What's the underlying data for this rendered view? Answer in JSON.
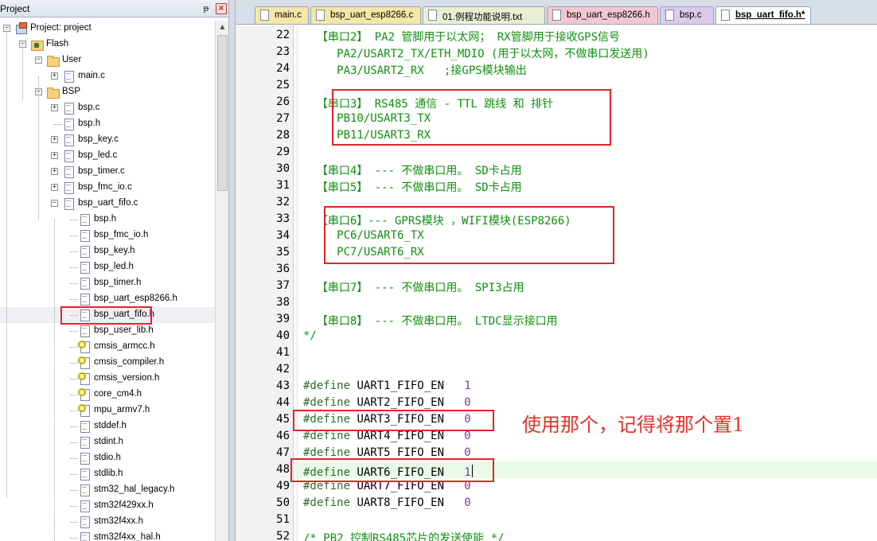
{
  "panel": {
    "title": "Project",
    "pin_glyph": "ᵽ",
    "close_glyph": "×"
  },
  "tree": [
    {
      "label": "Project: project",
      "icon": "project-icon",
      "exp": "-"
    },
    {
      "label": "Flash",
      "icon": "target-icon",
      "exp": "-"
    },
    {
      "label": "User",
      "icon": "folder-icon",
      "exp": "-"
    },
    {
      "label": "main.c",
      "icon": "file-icon",
      "exp": "+"
    },
    {
      "label": "BSP",
      "icon": "folder-icon",
      "exp": "-"
    },
    {
      "label": "bsp.c",
      "icon": "file-icon",
      "exp": "+"
    },
    {
      "label": "bsp.h",
      "icon": "file-icon",
      "exp": ""
    },
    {
      "label": "bsp_key.c",
      "icon": "file-icon",
      "exp": "+"
    },
    {
      "label": "bsp_led.c",
      "icon": "file-icon",
      "exp": "+"
    },
    {
      "label": "bsp_timer.c",
      "icon": "file-icon",
      "exp": "+"
    },
    {
      "label": "bsp_fmc_io.c",
      "icon": "file-icon",
      "exp": "+"
    },
    {
      "label": "bsp_uart_fifo.c",
      "icon": "file-icon",
      "exp": "-"
    },
    {
      "label": "bsp.h",
      "icon": "file-icon",
      "exp": ""
    },
    {
      "label": "bsp_fmc_io.h",
      "icon": "file-icon",
      "exp": ""
    },
    {
      "label": "bsp_key.h",
      "icon": "file-icon",
      "exp": ""
    },
    {
      "label": "bsp_led.h",
      "icon": "file-icon",
      "exp": ""
    },
    {
      "label": "bsp_timer.h",
      "icon": "file-icon",
      "exp": ""
    },
    {
      "label": "bsp_uart_esp8266.h",
      "icon": "file-icon",
      "exp": ""
    },
    {
      "label": "bsp_uart_fifo.h",
      "icon": "file-icon",
      "exp": ""
    },
    {
      "label": "bsp_user_lib.h",
      "icon": "file-icon",
      "exp": ""
    },
    {
      "label": "cmsis_armcc.h",
      "icon": "key-file-icon",
      "exp": ""
    },
    {
      "label": "cmsis_compiler.h",
      "icon": "key-file-icon",
      "exp": ""
    },
    {
      "label": "cmsis_version.h",
      "icon": "key-file-icon",
      "exp": ""
    },
    {
      "label": "core_cm4.h",
      "icon": "key-file-icon",
      "exp": ""
    },
    {
      "label": "mpu_armv7.h",
      "icon": "key-file-icon",
      "exp": ""
    },
    {
      "label": "stddef.h",
      "icon": "file-icon",
      "exp": ""
    },
    {
      "label": "stdint.h",
      "icon": "file-icon",
      "exp": ""
    },
    {
      "label": "stdio.h",
      "icon": "file-icon",
      "exp": ""
    },
    {
      "label": "stdlib.h",
      "icon": "file-icon",
      "exp": ""
    },
    {
      "label": "stm32_hal_legacy.h",
      "icon": "file-icon",
      "exp": ""
    },
    {
      "label": "stm32f429xx.h",
      "icon": "file-icon",
      "exp": ""
    },
    {
      "label": "stm32f4xx.h",
      "icon": "file-icon",
      "exp": ""
    },
    {
      "label": "stm32f4xx_hal.h",
      "icon": "file-icon",
      "exp": ""
    }
  ],
  "tabs": [
    {
      "label": "main.c",
      "bg": "#f5e7a6"
    },
    {
      "label": "bsp_uart_esp8266.c",
      "bg": "#f5e7a6"
    },
    {
      "label": "01.例程功能说明.txt",
      "bg": "#e9efd2"
    },
    {
      "label": "bsp_uart_esp8266.h",
      "bg": "#f2c8d0"
    },
    {
      "label": "bsp.c",
      "bg": "#dcc9ee"
    },
    {
      "label": "bsp_uart_fifo.h*",
      "bg": "#ffffff"
    }
  ],
  "colors": {
    "accent_red": "#e0262a",
    "comment_green": "#109010",
    "current_line": "#e8fbe8"
  },
  "editor": {
    "lines": [
      {
        "n": "22",
        "text": "  【串口2】 PA2 管脚用于以太网； RX管脚用于接收GPS信号",
        "kind": "comment"
      },
      {
        "n": "23",
        "text": "     PA2/USART2_TX/ETH_MDIO (用于以太网，不做串口发送用)",
        "kind": "comment"
      },
      {
        "n": "24",
        "text": "     PA3/USART2_RX   ;接GPS模块输出",
        "kind": "comment"
      },
      {
        "n": "25",
        "text": "",
        "kind": "comment"
      },
      {
        "n": "26",
        "text": "  【串口3】 RS485 通信 - TTL 跳线 和 排针",
        "kind": "comment"
      },
      {
        "n": "27",
        "text": "     PB10/USART3_TX",
        "kind": "comment"
      },
      {
        "n": "28",
        "text": "     PB11/USART3_RX",
        "kind": "comment"
      },
      {
        "n": "29",
        "text": "",
        "kind": "comment"
      },
      {
        "n": "30",
        "text": "  【串口4】 --- 不做串口用。 SD卡占用",
        "kind": "comment"
      },
      {
        "n": "31",
        "text": "  【串口5】 --- 不做串口用。 SD卡占用",
        "kind": "comment"
      },
      {
        "n": "32",
        "text": "",
        "kind": "comment"
      },
      {
        "n": "33",
        "text": "  【串口6】--- GPRS模块 ，WIFI模块(ESP8266)",
        "kind": "comment"
      },
      {
        "n": "34",
        "text": "     PC6/USART6_TX",
        "kind": "comment"
      },
      {
        "n": "35",
        "text": "     PC7/USART6_RX",
        "kind": "comment"
      },
      {
        "n": "36",
        "text": "",
        "kind": "comment"
      },
      {
        "n": "37",
        "text": "  【串口7】 --- 不做串口用。 SPI3占用",
        "kind": "comment"
      },
      {
        "n": "38",
        "text": "",
        "kind": "comment"
      },
      {
        "n": "39",
        "text": "  【串口8】 --- 不做串口用。 LTDC显示接口用",
        "kind": "comment"
      },
      {
        "n": "40",
        "text": "*/",
        "kind": "comment"
      },
      {
        "n": "41",
        "text": "",
        "kind": "plain"
      },
      {
        "n": "42",
        "text": "",
        "kind": "plain"
      },
      {
        "n": "43",
        "kind": "define",
        "pre": "#define",
        "id": "UART1_FIFO_EN",
        "val": "1"
      },
      {
        "n": "44",
        "kind": "define",
        "pre": "#define",
        "id": "UART2_FIFO_EN",
        "val": "0"
      },
      {
        "n": "45",
        "kind": "define",
        "pre": "#define",
        "id": "UART3_FIFO_EN",
        "val": "0"
      },
      {
        "n": "46",
        "kind": "define",
        "pre": "#define",
        "id": "UART4_FIFO_EN",
        "val": "0"
      },
      {
        "n": "47",
        "kind": "define",
        "pre": "#define",
        "id": "UART5_FIFO_EN",
        "val": "0"
      },
      {
        "n": "48",
        "kind": "define",
        "pre": "#define",
        "id": "UART6_FIFO_EN",
        "val": "1"
      },
      {
        "n": "49",
        "kind": "define",
        "pre": "#define",
        "id": "UART7_FIFO_EN",
        "val": "0"
      },
      {
        "n": "50",
        "kind": "define",
        "pre": "#define",
        "id": "UART8_FIFO_EN",
        "val": "0"
      },
      {
        "n": "51",
        "text": "",
        "kind": "plain"
      },
      {
        "n": "52",
        "text": "/* PB2 控制RS485芯片的发送使能 */",
        "kind": "comment"
      }
    ]
  },
  "annotation": {
    "text": "使用那个，记得将那个置1"
  }
}
